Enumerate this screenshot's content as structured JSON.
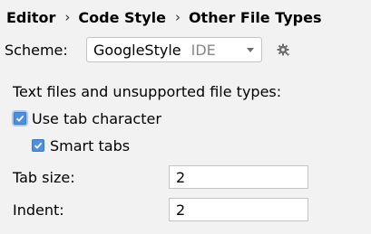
{
  "breadcrumb": {
    "items": [
      "Editor",
      "Code Style",
      "Other File Types"
    ],
    "separator": "›"
  },
  "scheme": {
    "label": "Scheme:",
    "value": "GoogleStyle",
    "tag": "IDE",
    "settings_icon": "gear-icon"
  },
  "section": {
    "title": "Text files and unsupported file types:"
  },
  "options": {
    "use_tab_character": {
      "label": "Use tab character",
      "checked": true
    },
    "smart_tabs": {
      "label": "Smart tabs",
      "checked": true
    }
  },
  "fields": {
    "tab_size": {
      "label": "Tab size:",
      "value": "2"
    },
    "indent": {
      "label": "Indent:",
      "value": "2"
    }
  },
  "colors": {
    "background": "#f2f2f2",
    "checkbox_accent": "#4d8ee0"
  }
}
